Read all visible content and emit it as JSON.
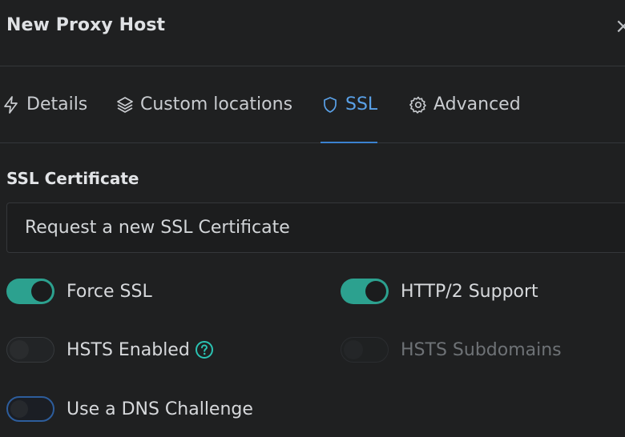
{
  "modal": {
    "title": "New Proxy Host",
    "close_symbol": "×"
  },
  "tabs": [
    {
      "label": "Details",
      "icon": "lightning-icon",
      "active": false
    },
    {
      "label": "Custom locations",
      "icon": "layers-icon",
      "active": false
    },
    {
      "label": "SSL",
      "icon": "shield-icon",
      "active": true
    },
    {
      "label": "Advanced",
      "icon": "gear-icon",
      "active": false
    }
  ],
  "ssl": {
    "certificate_label": "SSL Certificate",
    "certificate_value": "Request a new SSL Certificate",
    "toggles": {
      "force_ssl": {
        "label": "Force SSL",
        "state": "on"
      },
      "http2": {
        "label": "HTTP/2 Support",
        "state": "on"
      },
      "hsts": {
        "label": "HSTS Enabled",
        "state": "off"
      },
      "hsts_subdomains": {
        "label": "HSTS Subdomains",
        "state": "disabled"
      },
      "dns_challenge": {
        "label": "Use a DNS Challenge",
        "state": "off-focused"
      }
    }
  },
  "colors": {
    "accent_blue": "#5aa1e8",
    "toggle_on": "#2ca18f",
    "help_teal": "#2bc3b3",
    "background": "#1f2021"
  }
}
